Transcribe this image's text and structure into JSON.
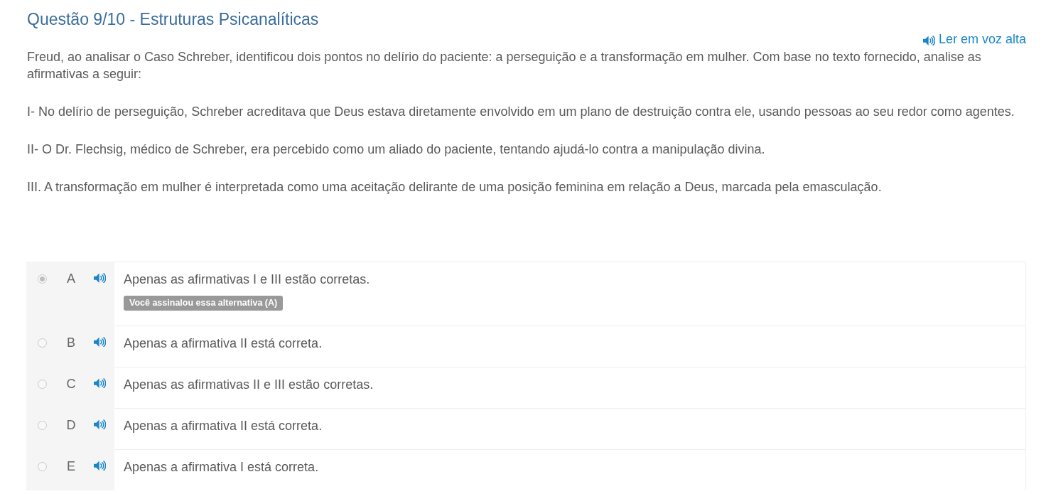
{
  "question": {
    "title": "Questão 9/10 - Estruturas Psicanalíticas",
    "read_aloud": "Ler em voz alta",
    "paragraphs": [
      "Freud, ao analisar o Caso Schreber, identificou dois pontos no delírio do paciente: a perseguição e a transformação em mulher. Com base no texto fornecido, analise as afirmativas a seguir:",
      "I- No delírio de perseguição, Schreber acreditava que Deus estava diretamente envolvido em um plano de destruição contra ele, usando pessoas ao seu redor como agentes.",
      "II- O Dr. Flechsig, médico de Schreber, era percebido como um aliado do paciente, tentando ajudá-lo contra a manipulação divina.",
      "III. A transformação em mulher é interpretada como uma aceitação delirante de uma posição feminina em relação a Deus, marcada pela emasculação."
    ]
  },
  "options": [
    {
      "letter": "A",
      "text": "Apenas as afirmativas I e III estão corretas.",
      "selected": true,
      "note": "Você assinalou essa alternativa (A)"
    },
    {
      "letter": "B",
      "text": "Apenas a afirmativa II está correta.",
      "selected": false
    },
    {
      "letter": "C",
      "text": "Apenas as afirmativas II e III estão corretas.",
      "selected": false
    },
    {
      "letter": "D",
      "text": "Apenas a afirmativa II está correta.",
      "selected": false
    },
    {
      "letter": "E",
      "text": "Apenas a afirmativa I está correta.",
      "selected": false
    }
  ]
}
